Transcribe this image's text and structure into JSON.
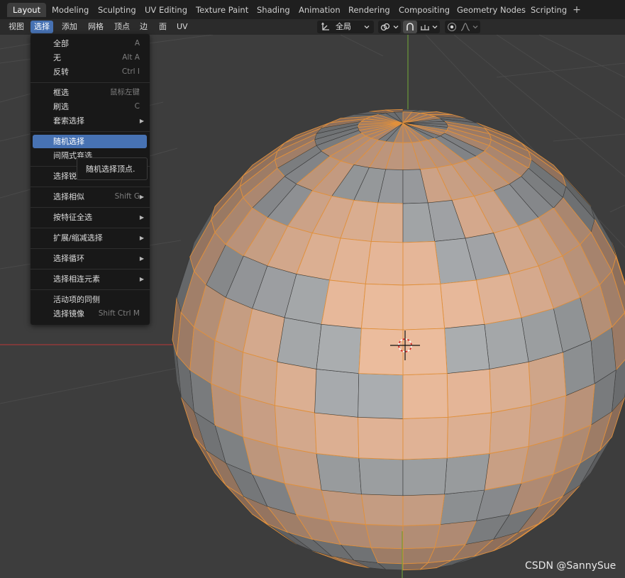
{
  "workspace_tabs": [
    {
      "label": "Layout",
      "active": true
    },
    {
      "label": "Modeling"
    },
    {
      "label": "Sculpting"
    },
    {
      "label": "UV Editing"
    },
    {
      "label": "Texture Paint"
    },
    {
      "label": "Shading"
    },
    {
      "label": "Animation"
    },
    {
      "label": "Rendering"
    },
    {
      "label": "Compositing"
    },
    {
      "label": "Geometry Nodes"
    },
    {
      "label": "Scripting"
    }
  ],
  "add_tab_label": "+",
  "header_menu": [
    {
      "label": "视图"
    },
    {
      "label": "选择",
      "active": true
    },
    {
      "label": "添加"
    },
    {
      "label": "网格"
    },
    {
      "label": "顶点"
    },
    {
      "label": "边"
    },
    {
      "label": "面"
    },
    {
      "label": "UV"
    }
  ],
  "transform_orientation": "全局",
  "select_menu": {
    "groups": [
      [
        {
          "label": "全部",
          "shortcut": "A"
        },
        {
          "label": "无",
          "shortcut": "Alt A"
        },
        {
          "label": "反转",
          "shortcut": "Ctrl I"
        }
      ],
      [
        {
          "label": "框选",
          "shortcut": "鼠标左键"
        },
        {
          "label": "刷选",
          "shortcut": "C"
        },
        {
          "label": "套索选择",
          "submenu": true
        }
      ],
      [
        {
          "label": "随机选择",
          "highlighted": true
        },
        {
          "label": "间隔式弃选"
        }
      ],
      [
        {
          "label": "选择锐边"
        }
      ],
      [
        {
          "label": "选择相似",
          "shortcut": "Shift G",
          "submenu": true
        }
      ],
      [
        {
          "label": "按特征全选",
          "submenu": true
        }
      ],
      [
        {
          "label": "扩展/缩减选择",
          "submenu": true
        }
      ],
      [
        {
          "label": "选择循环",
          "submenu": true
        }
      ],
      [
        {
          "label": "选择相连元素",
          "submenu": true
        }
      ],
      [
        {
          "label": "活动项的同侧"
        },
        {
          "label": "选择镜像",
          "shortcut": "Shift Ctrl M"
        }
      ]
    ]
  },
  "tooltip": "随机选择顶点.",
  "watermark": "CSDN @SannySue",
  "colors": {
    "accent": "#4772b3",
    "selected_edge": "#e0903c",
    "selected_face": "#d9a98a",
    "unselected_face": "#9a9da0",
    "x_axis": "#a33a3a",
    "z_axis": "#6a9a3a"
  }
}
